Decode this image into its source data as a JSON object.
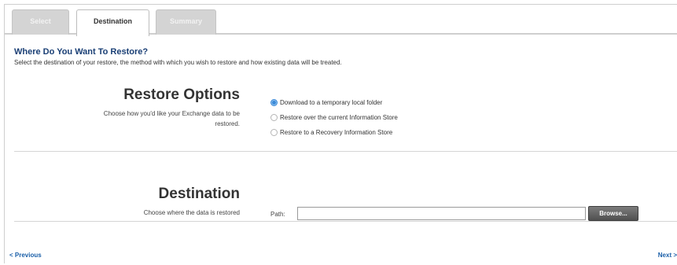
{
  "tabs": [
    {
      "label": "Select",
      "active": false
    },
    {
      "label": "Destination",
      "active": true
    },
    {
      "label": "Summary",
      "active": false
    }
  ],
  "header": {
    "title": "Where Do You Want To Restore?",
    "subtitle": "Select the destination of your restore, the method with which you wish to restore and how existing data will be treated."
  },
  "restore_options": {
    "title": "Restore Options",
    "description": "Choose how you'd like your Exchange data to be restored.",
    "options": [
      {
        "label": "Download to a temporary local folder",
        "checked": true
      },
      {
        "label": "Restore over the current Information Store",
        "checked": false
      },
      {
        "label": "Restore to a Recovery Information Store",
        "checked": false
      }
    ]
  },
  "destination": {
    "title": "Destination",
    "description": "Choose where the data is restored",
    "path_label": "Path:",
    "path_value": "",
    "browse_label": "Browse..."
  },
  "nav": {
    "previous_label": "< Previous",
    "next_label": "Next >"
  },
  "colors": {
    "heading": "#1a3f75",
    "link": "#1a5fa8",
    "radio_checked": "#3b8ad9",
    "button": "#5a5a5a"
  }
}
